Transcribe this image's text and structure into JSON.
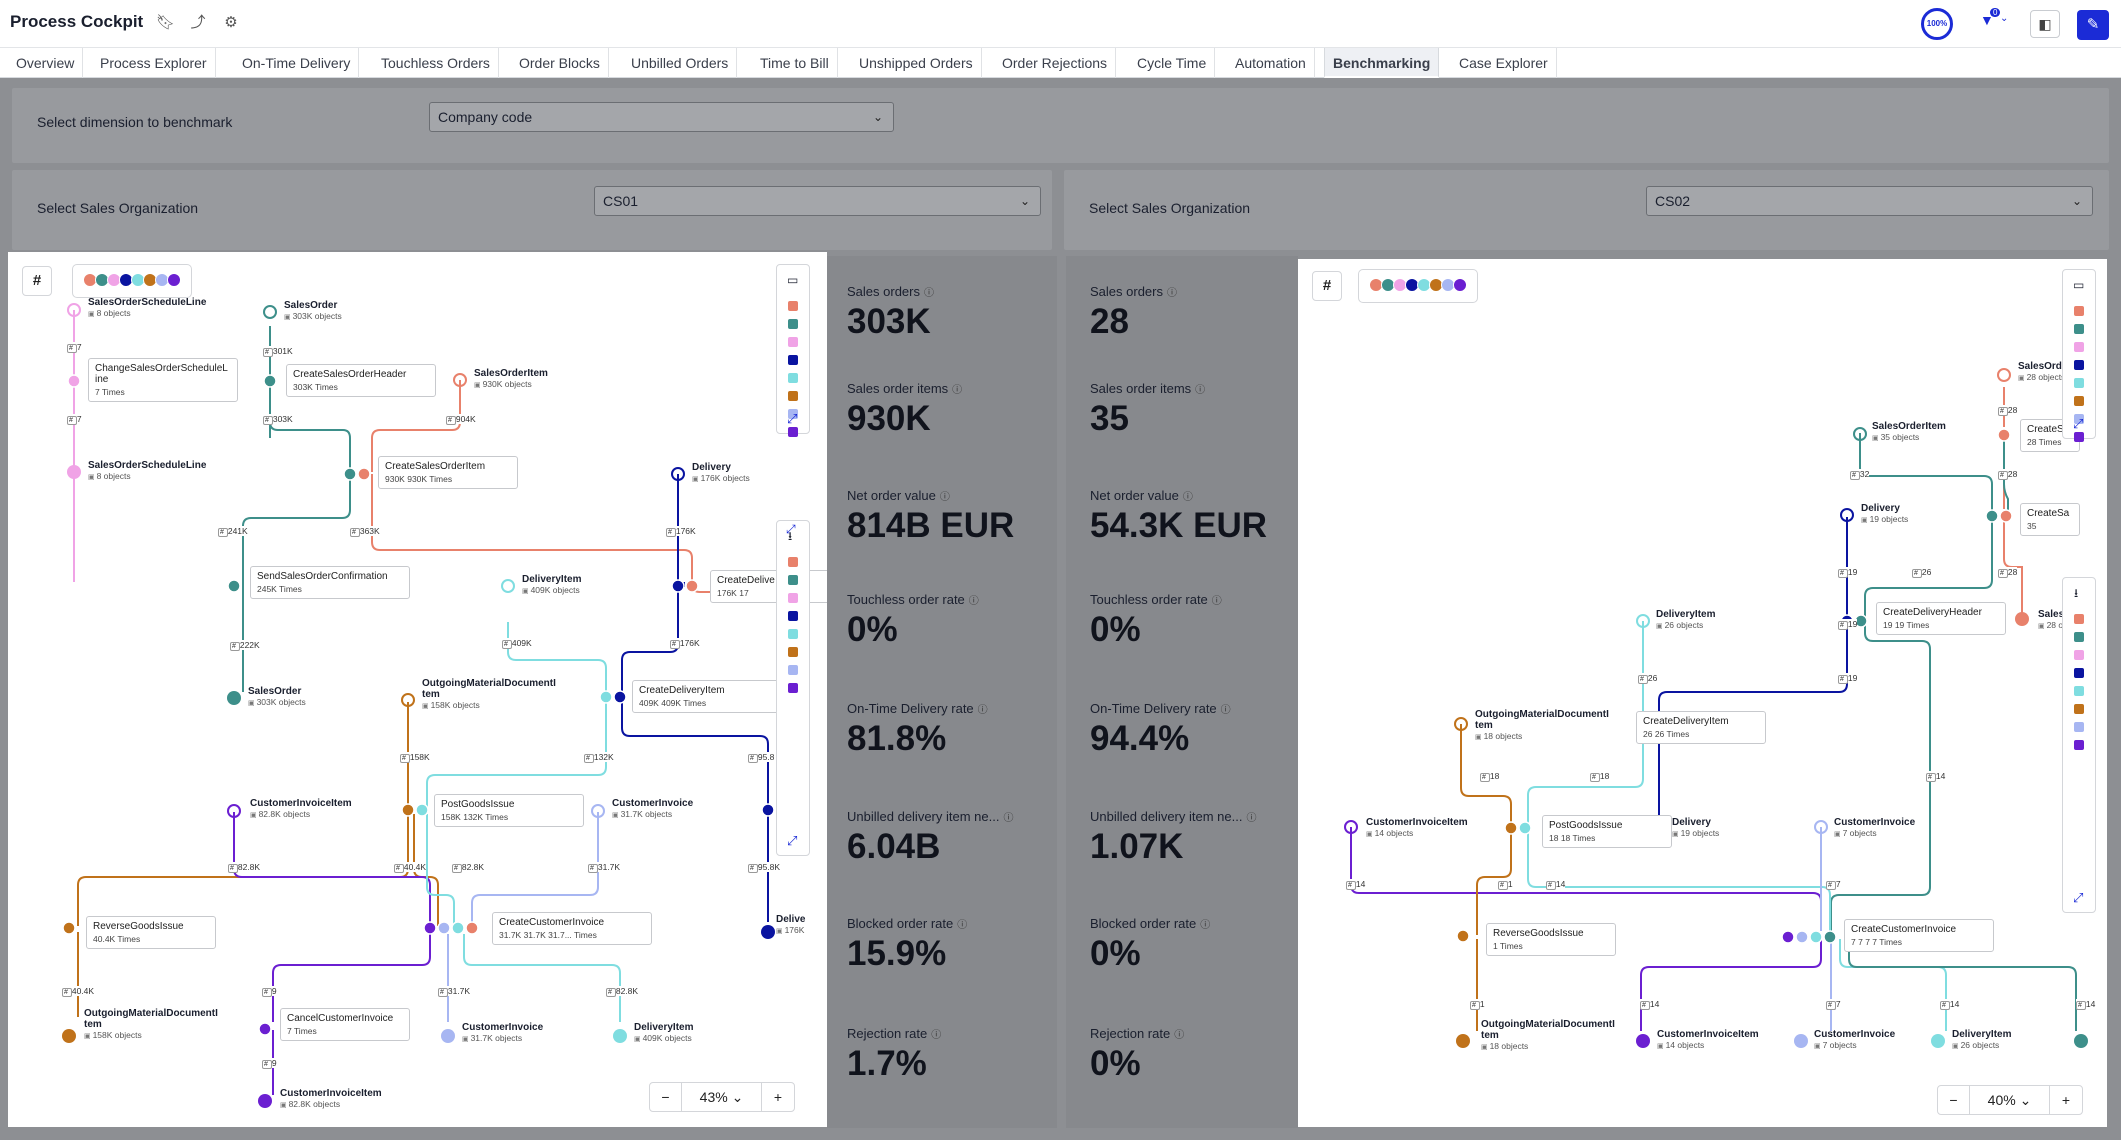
{
  "header": {
    "title": "Process Cockpit",
    "progress_label": "100%",
    "filter_count": "0"
  },
  "tabs": [
    "Overview",
    "Process Explorer",
    "On-Time Delivery",
    "Touchless Orders",
    "Order Blocks",
    "Unbilled Orders",
    "Time to Bill",
    "Unshipped Orders",
    "Order Rejections",
    "Cycle Time",
    "Automation",
    "Benchmarking",
    "Case Explorer"
  ],
  "active_tab": "Benchmarking",
  "benchmark": {
    "dimension_label": "Select dimension to benchmark",
    "dimension_value": "Company code"
  },
  "left": {
    "org_label": "Select Sales Organization",
    "org_value": "CS01",
    "zoom": "43%",
    "graph": {
      "nodes": [
        {
          "title": "SalesOrderScheduleLine",
          "sub": "8 objects"
        },
        {
          "title": "SalesOrder",
          "sub": "303K objects"
        },
        {
          "title": "SalesOrderItem",
          "sub": "930K objects"
        },
        {
          "title": "SalesOrderScheduleLine",
          "sub": "8 objects"
        },
        {
          "title": "Delivery",
          "sub": "176K objects"
        },
        {
          "title": "DeliveryItem",
          "sub": "409K objects"
        },
        {
          "title": "SalesOrder",
          "sub": "303K objects"
        },
        {
          "title": "OutgoingMaterialDocumentI",
          "title2": "tem",
          "sub": "158K objects"
        },
        {
          "title": "CustomerInvoiceItem",
          "sub": "82.8K objects"
        },
        {
          "title": "CustomerInvoice",
          "sub": "31.7K objects"
        },
        {
          "title": "OutgoingMaterialDocumentI",
          "title2": "tem",
          "sub": "158K objects"
        },
        {
          "title": "CustomerInvoice",
          "sub": "31.7K objects"
        },
        {
          "title": "DeliveryItem",
          "sub": "409K objects"
        },
        {
          "title": "CustomerInvoiceItem",
          "sub": "82.8K objects"
        },
        {
          "title": "Delive",
          "sub": "176K"
        }
      ],
      "activities": [
        {
          "title": "ChangeSalesOrderScheduleL",
          "title2": "ine",
          "sub": "7 Times"
        },
        {
          "title": "CreateSalesOrderHeader",
          "sub": "303K Times"
        },
        {
          "title": "CreateSalesOrderItem",
          "sub": "930K",
          "sub2": "930K Times"
        },
        {
          "title": "SendSalesOrderConfirmation",
          "sub": "245K Times"
        },
        {
          "title": "CreateDelive",
          "sub": "176K",
          "sub2": "17"
        },
        {
          "title": "CreateDeliveryItem",
          "sub": "409K",
          "sub2": "409K Times"
        },
        {
          "title": "PostGoodsIssue",
          "sub": "158K",
          "sub2": "132K Times"
        },
        {
          "title": "ReverseGoodsIssue",
          "sub": "40.4K Times"
        },
        {
          "title": "CreateCustomerInvoice",
          "sub": "31.7K",
          "sub2": "31.7K",
          "sub3": "31.7...",
          "sub4": "Times"
        },
        {
          "title": "CancelCustomerInvoice",
          "sub": "7 Times"
        }
      ],
      "edges": [
        "7",
        "7",
        "301K",
        "303K",
        "904K",
        "241K",
        "363K",
        "176K",
        "222K",
        "409K",
        "176K",
        "158K",
        "132K",
        "95.8",
        "82.8K",
        "40.4K",
        "82.8K",
        "31.7K",
        "95.8K",
        "40.4K",
        "9",
        "31.7K",
        "82.8K",
        "9"
      ]
    }
  },
  "right": {
    "org_label": "Select Sales Organization",
    "org_value": "CS02",
    "zoom": "40%",
    "graph": {
      "nodes": [
        {
          "title": "SalesOrde",
          "sub": "28 objects"
        },
        {
          "title": "SalesOrderItem",
          "sub": "35 objects"
        },
        {
          "title": "Delivery",
          "sub": "19 objects"
        },
        {
          "title": "SalesO",
          "sub": "28 o"
        },
        {
          "title": "DeliveryItem",
          "sub": "26 objects"
        },
        {
          "title": "OutgoingMaterialDocumentI",
          "title2": "tem",
          "sub": "18 objects"
        },
        {
          "title": "CustomerInvoiceItem",
          "sub": "14 objects"
        },
        {
          "title": "Delivery",
          "sub": "19 objects"
        },
        {
          "title": "CustomerInvoice",
          "sub": "7 objects"
        },
        {
          "title": "OutgoingMaterialDocumentI",
          "title2": "tem",
          "sub": "18 objects"
        },
        {
          "title": "CustomerInvoiceItem",
          "sub": "14 objects"
        },
        {
          "title": "CustomerInvoice",
          "sub": "7 objects"
        },
        {
          "title": "DeliveryItem",
          "sub": "26 objects"
        }
      ],
      "activities": [
        {
          "title": "CreateSa",
          "sub": "28 Times"
        },
        {
          "title": "CreateSa",
          "sub": "35"
        },
        {
          "title": "CreateDeliveryHeader",
          "sub": "19",
          "sub2": "19 Times"
        },
        {
          "title": "CreateDeliveryItem",
          "sub": "26",
          "sub2": "26 Times"
        },
        {
          "title": "PostGoodsIssue",
          "sub": "18",
          "sub2": "18 Times"
        },
        {
          "title": "ReverseGoodsIssue",
          "sub": "1 Times"
        },
        {
          "title": "CreateCustomerInvoice",
          "sub": "7",
          "sub2": "7",
          "sub3": "7",
          "sub4": "7 Times"
        }
      ],
      "edges": [
        "28",
        "28",
        "32",
        "26",
        "19",
        "28",
        "19",
        "26",
        "19",
        "18",
        "18",
        "14",
        "14",
        "14",
        "1",
        "7",
        "7",
        "1",
        "14",
        "7",
        "14",
        "14"
      ]
    }
  },
  "kpis": {
    "labels": [
      "Sales orders",
      "Sales order items",
      "Net order value",
      "Touchless order rate",
      "On-Time Delivery rate",
      "Unbilled delivery item ne...",
      "Blocked order rate",
      "Rejection rate"
    ],
    "left_values": [
      "303K",
      "930K",
      "814B EUR",
      "0%",
      "81.8%",
      "6.04B",
      "15.9%",
      "1.7%"
    ],
    "right_values": [
      "28",
      "35",
      "54.3K EUR",
      "0%",
      "94.4%",
      "1.07K",
      "0%",
      "0%"
    ]
  },
  "colors": {
    "accent": "#1b2bd6",
    "salmon": "#e8816b",
    "teal": "#3d8f8a",
    "pink": "#f0a3e6",
    "navy": "#0a14a0",
    "aqua": "#7fdde0",
    "orange": "#c0721a",
    "lavender": "#a7b6f2",
    "purple": "#6b1fd1"
  },
  "legend_colors": [
    "#e8816b",
    "#3d8f8a",
    "#f0a3e6",
    "#0a14a0",
    "#7fdde0",
    "#c0721a",
    "#a7b6f2",
    "#6b1fd1"
  ]
}
